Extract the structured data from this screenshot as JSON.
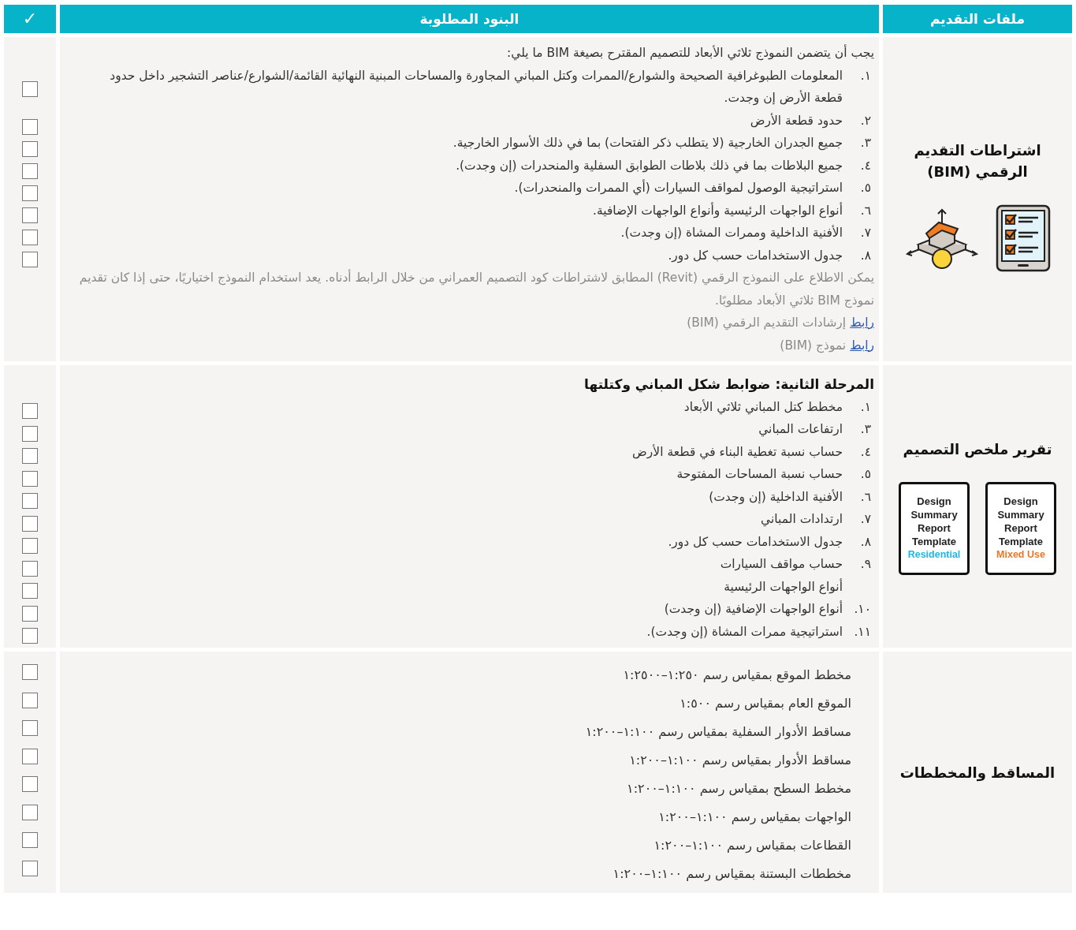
{
  "header": {
    "files": "ملفات التقديم",
    "items": "البنود المطلوبة",
    "check": "✓"
  },
  "sections": [
    {
      "kind": "bim",
      "title": "اشتراطات التقديم الرقمي (BIM)",
      "intro": "يجب أن يتضمن النموذج ثلاثي الأبعاد للتصميم المقترح بصيغة BIM ما يلي:",
      "items": [
        {
          "number": "١.",
          "text": "المعلومات الطبوغرافية الصحيحة والشوارع/الممرات وكتل المباني المجاورة والمساحات المبنية النهائية القائمة/الشوارع/عناصر التشجير داخل حدود قطعة الأرض إن وجدت."
        },
        {
          "number": "٢.",
          "text": "حدود قطعة الأرض"
        },
        {
          "number": "٣.",
          "text": "جميع الجدران الخارجية (لا يتطلب ذكر الفتحات) بما في ذلك الأسوار الخارجية."
        },
        {
          "number": "٤.",
          "text": "جميع البلاطات بما في ذلك بلاطات الطوابق السفلية والمنحدرات (إن وجدت)."
        },
        {
          "number": "٥.",
          "text": "استراتيجية الوصول لمواقف السيارات (أي الممرات والمنحدرات)."
        },
        {
          "number": "٦.",
          "text": "أنواع الواجهات الرئيسية وأنواع الواجهات الإضافية."
        },
        {
          "number": "٧.",
          "text": "الأفنية الداخلية وممرات المشاة (إن وجدت)."
        },
        {
          "number": "٨.",
          "text": "جدول الاستخدامات حسب كل دور."
        }
      ],
      "note": "يمكن الاطلاع على النموذج الرقمي (Revit) المطابق لاشتراطات كود التصميم العمراني من خلال الرابط أدناه. يعد استخدام النموذج اختياريًا، حتى إذا كان تقديم نموذج BIM ثلاثي الأبعاد مطلوبًا.",
      "links": [
        {
          "link": "رابط",
          "text": "إرشادات التقديم الرقمي (BIM)"
        },
        {
          "link": "رابط",
          "text": "نموذج (BIM)"
        }
      ],
      "checkboxes": [
        {
          "checked": false
        },
        {
          "checked": false
        },
        {
          "checked": false
        },
        {
          "checked": false
        },
        {
          "checked": false
        },
        {
          "checked": false
        },
        {
          "checked": false
        },
        {
          "checked": false
        }
      ]
    },
    {
      "kind": "templates",
      "title": "تقرير ملخص التصميم",
      "heading": "المرحلة الثانية: ضوابط شكل المباني وكتلتها",
      "items": [
        {
          "number": "١.",
          "text": "مخطط كتل المباني ثلاثي الأبعاد"
        },
        {
          "number": "٣.",
          "text": "ارتفاعات المباني"
        },
        {
          "number": "٤.",
          "text": "حساب نسبة تغطية البناء في قطعة الأرض"
        },
        {
          "number": "٥.",
          "text": "حساب نسبة المساحات المفتوحة"
        },
        {
          "number": "٦.",
          "text": "الأفنية الداخلية (إن وجدت)"
        },
        {
          "number": "٧.",
          "text": "ارتدادات المباني"
        },
        {
          "number": "٨.",
          "text": "جدول الاستخدامات حسب كل دور."
        },
        {
          "number": "٩.",
          "text": "حساب مواقف السيارات"
        },
        {
          "text": "أنواع الواجهات الرئيسية"
        },
        {
          "number": "١٠.",
          "text": "أنواع الواجهات الإضافية (إن وجدت)"
        },
        {
          "number": "١١.",
          "text": "استراتيجية ممرات المشاة (إن وجدت)."
        }
      ],
      "templates": [
        {
          "title": "Design Summary Report Template",
          "subtitle": "Mixed Use",
          "color": "#e8782a"
        },
        {
          "title": "Design Summary Report Template",
          "subtitle": "Residential",
          "color": "#1cb8e6"
        }
      ],
      "checkboxes": [
        {
          "checked": false
        },
        {
          "checked": false
        },
        {
          "checked": false
        },
        {
          "checked": false
        },
        {
          "checked": false
        },
        {
          "checked": false
        },
        {
          "checked": false
        },
        {
          "checked": false
        },
        {
          "checked": false
        },
        {
          "checked": false
        },
        {
          "checked": false
        }
      ]
    },
    {
      "kind": "plans",
      "title": "المساقط والمخططات",
      "items": [
        {
          "text": "مخطط الموقع بمقياس رسم ١:٢٥٠–١:٢٥٠٠"
        },
        {
          "text": "الموقع العام بمقياس رسم ١:٥٠٠"
        },
        {
          "text": "مساقط الأدوار السفلية بمقياس رسم ١:١٠٠–١:٢٠٠"
        },
        {
          "text": "مساقط الأدوار بمقياس رسم ١:١٠٠–١:٢٠٠"
        },
        {
          "text": "مخطط السطح بمقياس رسم ١:١٠٠–١:٢٠٠"
        },
        {
          "text": "الواجهات بمقياس رسم ١:١٠٠–١:٢٠٠"
        },
        {
          "text": "القطاعات بمقياس رسم ١:١٠٠–١:٢٠٠"
        },
        {
          "text": "مخططات البستنة بمقياس رسم ١:١٠٠–١:٢٠٠"
        }
      ],
      "checkboxes": [
        {
          "checked": false
        },
        {
          "checked": false
        },
        {
          "checked": false
        },
        {
          "checked": false
        },
        {
          "checked": false
        },
        {
          "checked": false
        },
        {
          "checked": false
        },
        {
          "checked": false
        }
      ]
    }
  ]
}
